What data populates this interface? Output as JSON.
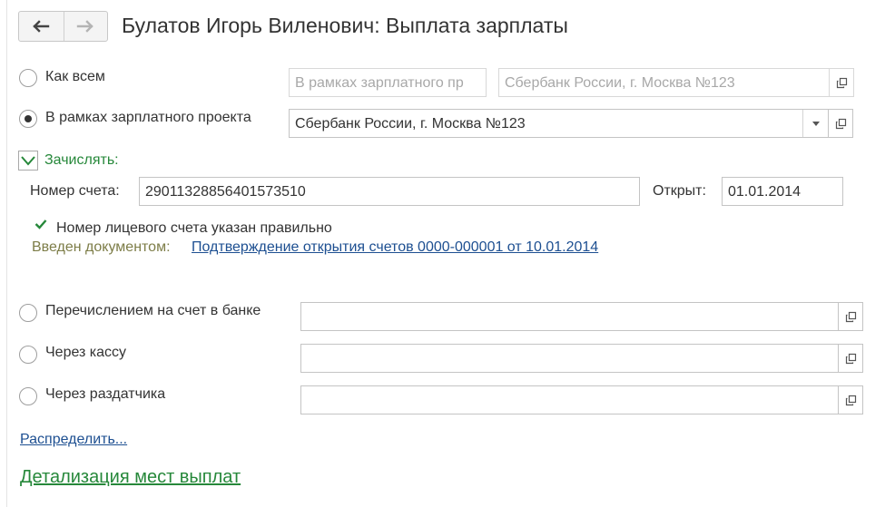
{
  "window": {
    "title": "Булатов Игорь Виленович: Выплата зарплаты"
  },
  "options": {
    "as_all": {
      "label": "Как всем",
      "field1_value": "В рамках зарплатного пр",
      "field2_value": "Сбербанк России, г. Москва №123"
    },
    "salary_project": {
      "label": "В рамках зарплатного проекта",
      "selected": true,
      "field_value": "Сбербанк России, г. Москва №123"
    },
    "bank_transfer": {
      "label": "Перечислением на счет в банке",
      "field_value": ""
    },
    "cash_desk": {
      "label": "Через кассу",
      "field_value": ""
    },
    "distributor": {
      "label": "Через раздатчика",
      "field_value": ""
    }
  },
  "accrue": {
    "label": "Зачислять:",
    "checked": true,
    "account_label": "Номер счета:",
    "account_value": "29011328856401573510",
    "opened_label": "Открыт:",
    "opened_value": "01.01.2014",
    "validation_text": "Номер лицевого счета указан правильно",
    "entered_label": "Введен документом:",
    "entered_link": "Подтверждение открытия счетов 0000-000001 от 10.01.2014"
  },
  "links": {
    "distribute": "Распределить...",
    "details": "Детализация мест выплат"
  },
  "colors": {
    "accent_green": "#26883a",
    "link_blue": "#1d4f91",
    "disabled_text": "#a8a8a8"
  },
  "icons": [
    "arrow-left-icon",
    "arrow-right-icon",
    "open-form-icon",
    "dropdown-arrow-icon",
    "checkmark-icon"
  ]
}
